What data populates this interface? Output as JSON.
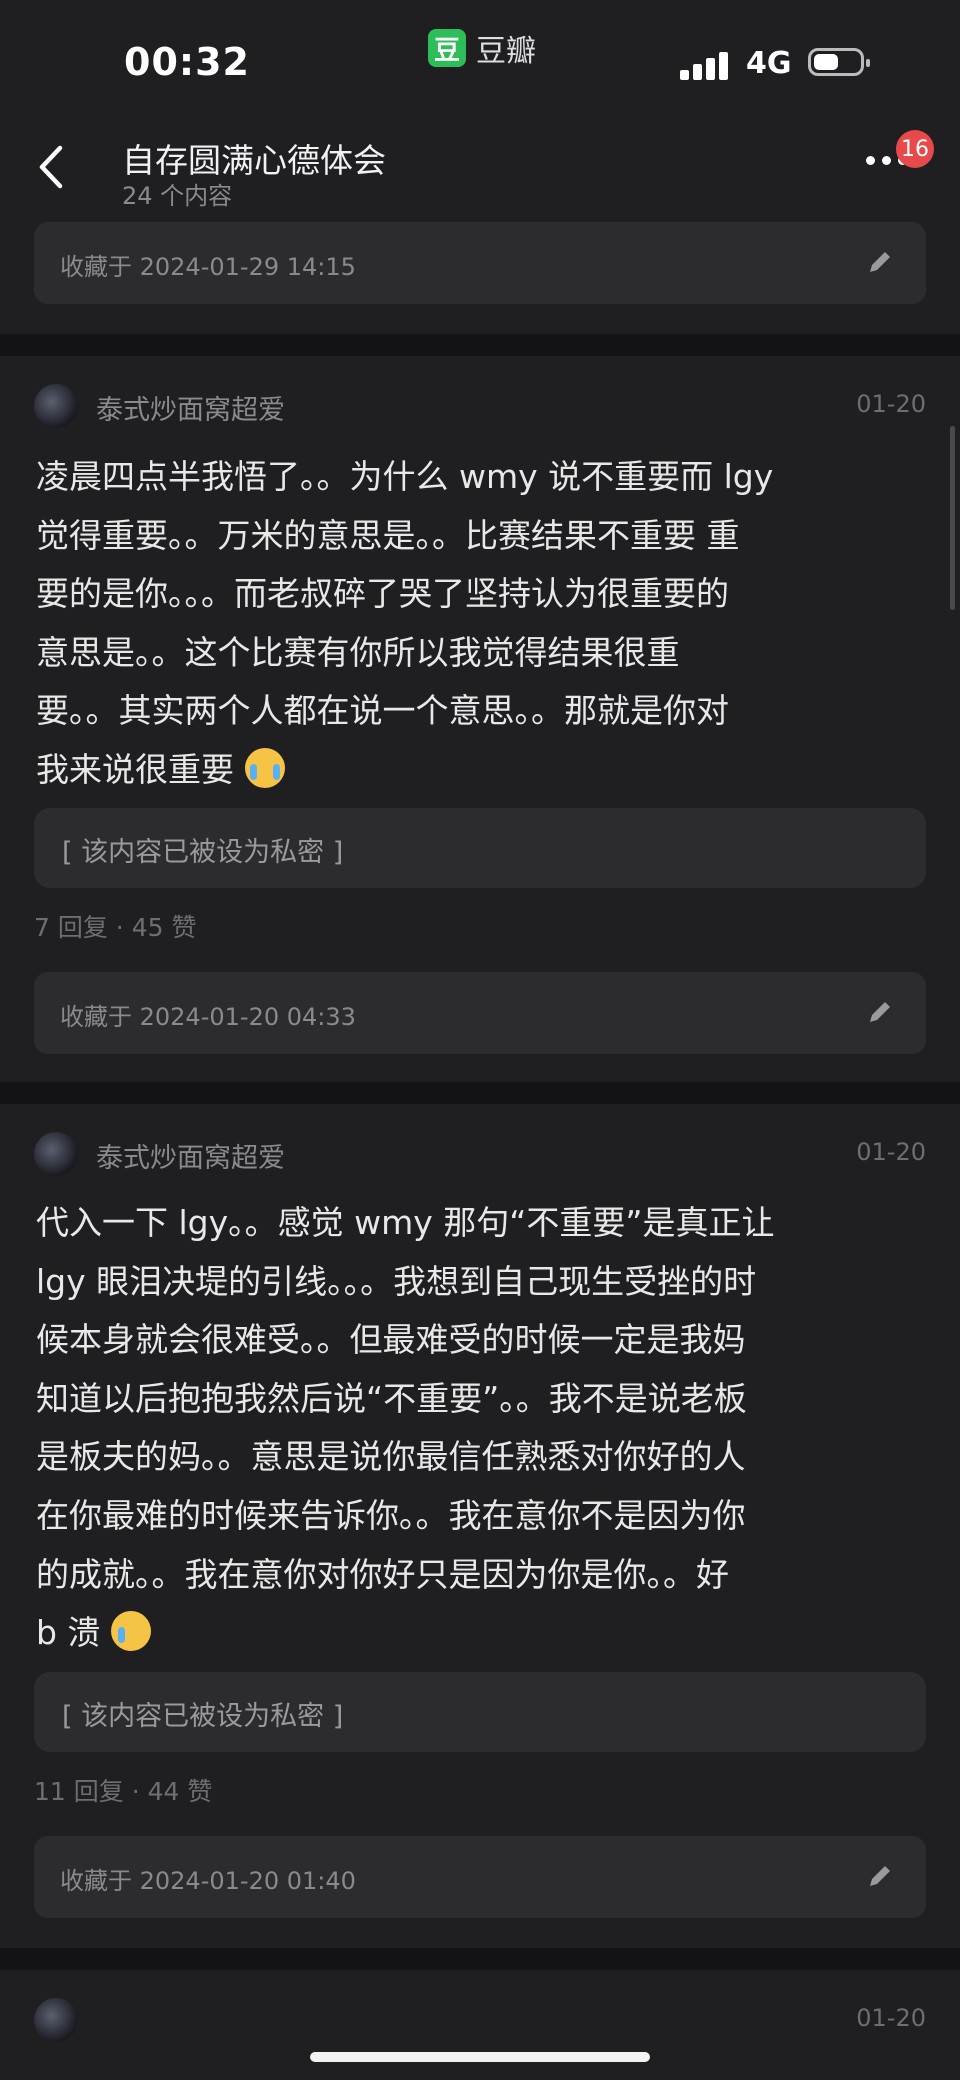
{
  "status_bar": {
    "time": "00:32",
    "app_name": "豆瓣",
    "app_icon_char": "豆",
    "network": "4G"
  },
  "header": {
    "title": "自存圆满心德体会",
    "subtitle": "24 个内容",
    "badge_count": "16"
  },
  "card0": {
    "saved_text": "收藏于 2024-01-29 14:15"
  },
  "posts": [
    {
      "author": "泰式炒面窝超爱",
      "date": "01-20",
      "lines": [
        "凌晨四点半我悟了。。为什么 wmy 说不重要而 lgy",
        "觉得重要。。万米的意思是。。比赛结果不重要 重",
        "要的是你。。。而老叔碎了哭了坚持认为很重要的",
        "意思是。。这个比赛有你所以我觉得结果很重",
        "要。。其实两个人都在说一个意思。。那就是你对",
        "我来说很重要"
      ],
      "emoji": "crying-face",
      "private_text": "[ 该内容已被设为私密 ]",
      "stats": "7 回复 · 45 赞",
      "saved_text": "收藏于 2024-01-20 04:33"
    },
    {
      "author": "泰式炒面窝超爱",
      "date": "01-20",
      "lines": [
        "代入一下 lgy。。感觉 wmy 那句“不重要”是真正让",
        "lgy 眼泪决堤的引线。。。我想到自己现生受挫的时",
        "候本身就会很难受。。但最难受的时候一定是我妈",
        "知道以后抱抱我然后说“不重要”。。我不是说老板",
        "是板夫的妈。。意思是说你最信任熟悉对你好的人",
        "在你最难的时候来告诉你。。我在意你不是因为你",
        "的成就。。我在意你对你好只是因为你是你。。好",
        "b 溃"
      ],
      "emoji": "tearful-smile",
      "private_text": "[ 该内容已被设为私密 ]",
      "stats": "11 回复 · 44 赞",
      "saved_text": "收藏于 2024-01-20 01:40"
    },
    {
      "date": "01-20"
    }
  ],
  "colors": {
    "background": "#131316",
    "card": "#1f1f22",
    "inner": "#2c2c30",
    "badge": "#e8494b",
    "brand": "#2dbe5a"
  }
}
